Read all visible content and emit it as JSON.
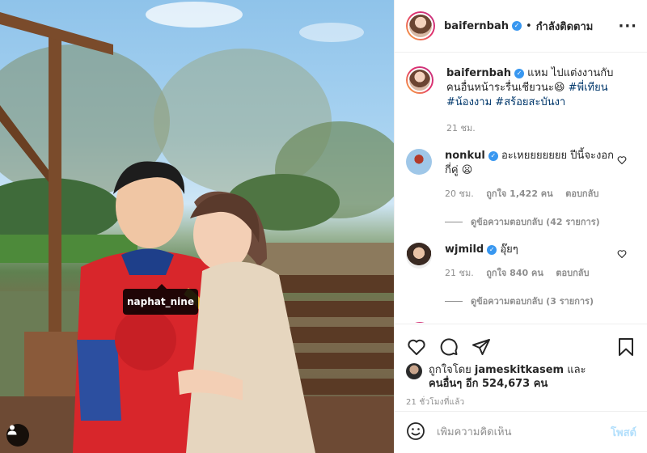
{
  "photo": {
    "tag_label": "naphat_nine"
  },
  "header": {
    "username": "baifernbah",
    "follow_status": "กำลังติดตาม",
    "more_label": "···",
    "separator": "•"
  },
  "caption": {
    "username": "baifernbah",
    "text": " แหม ไปแต่งงานกับคนอื่นหน้าระรื่นเชียวนะ😆 ",
    "hashtags": [
      "#พี่เทียน",
      "#น้องงาม",
      "#สร้อยสะบันงา"
    ],
    "time": "21 ชม."
  },
  "comments": [
    {
      "username": "nonkul",
      "text": " อะเหยยยยยยย ปีนี้จะงอกกี่คู่ 😦",
      "time": "20 ชม.",
      "likes": "ถูกใจ 1,422 คน",
      "reply": "ตอบกลับ",
      "view_replies": "ดูข้อความตอบกลับ (42 รายการ)"
    },
    {
      "username": "wjmild",
      "text": " อุ๊ยๆ",
      "time": "21 ชม.",
      "likes": "ถูกใจ 840 คน",
      "reply": "ตอบกลับ",
      "view_replies": "ดูข้อความตอบกลับ (3 รายการ)"
    }
  ],
  "likes_section": {
    "prefix": "ถูกใจโดย ",
    "liker": "jameskitkasem",
    "middle": " และ",
    "others": "คนอื่นๆ อีก 524,673 คน"
  },
  "post_time": "21 ชั่วโมงที่แล้ว",
  "add_comment": {
    "placeholder": "เพิ่มความคิดเห็น",
    "post_label": "โพสต์"
  },
  "icons": {
    "verified": "verified-badge-icon",
    "heart": "heart-icon",
    "comment": "comment-icon",
    "share": "share-icon",
    "save": "bookmark-icon",
    "emoji": "emoji-icon",
    "user_tag": "user-tag-icon"
  },
  "colors": {
    "verified": "#3897f0",
    "hashtag": "#00376b",
    "muted": "#8e8e8e",
    "post_disabled": "#b2dffc"
  }
}
